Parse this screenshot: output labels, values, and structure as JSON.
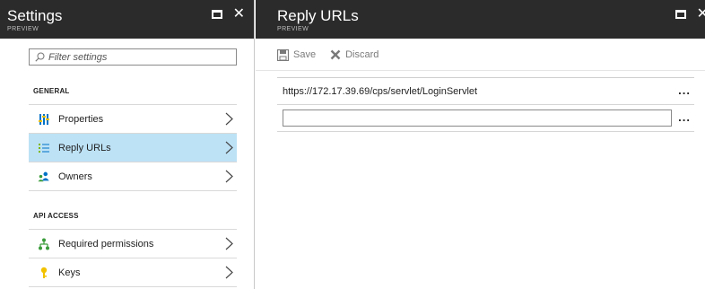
{
  "settings_blade": {
    "title": "Settings",
    "subtitle": "PREVIEW",
    "filter": {
      "placeholder": "Filter settings",
      "value": ""
    },
    "sections": [
      {
        "heading": "GENERAL",
        "items": [
          {
            "label": "Properties",
            "icon": "properties-icon",
            "selected": false
          },
          {
            "label": "Reply URLs",
            "icon": "reply-urls-icon",
            "selected": true
          },
          {
            "label": "Owners",
            "icon": "owners-icon",
            "selected": false
          }
        ]
      },
      {
        "heading": "API ACCESS",
        "items": [
          {
            "label": "Required permissions",
            "icon": "permissions-icon",
            "selected": false
          },
          {
            "label": "Keys",
            "icon": "key-icon",
            "selected": false
          }
        ]
      }
    ]
  },
  "reply_urls_blade": {
    "title": "Reply URLs",
    "subtitle": "PREVIEW",
    "toolbar": {
      "save_label": "Save",
      "discard_label": "Discard"
    },
    "urls": [
      "https://172.17.39.69/cps/servlet/LoginServlet"
    ],
    "new_url": {
      "value": "",
      "placeholder": ""
    },
    "more_label": "..."
  },
  "colors": {
    "header_bg": "#2b2b2b",
    "selected_bg": "#bde2f6",
    "accent_blue": "#0072c6",
    "accent_green": "#3a9b3a",
    "accent_yellow": "#f2c200"
  }
}
